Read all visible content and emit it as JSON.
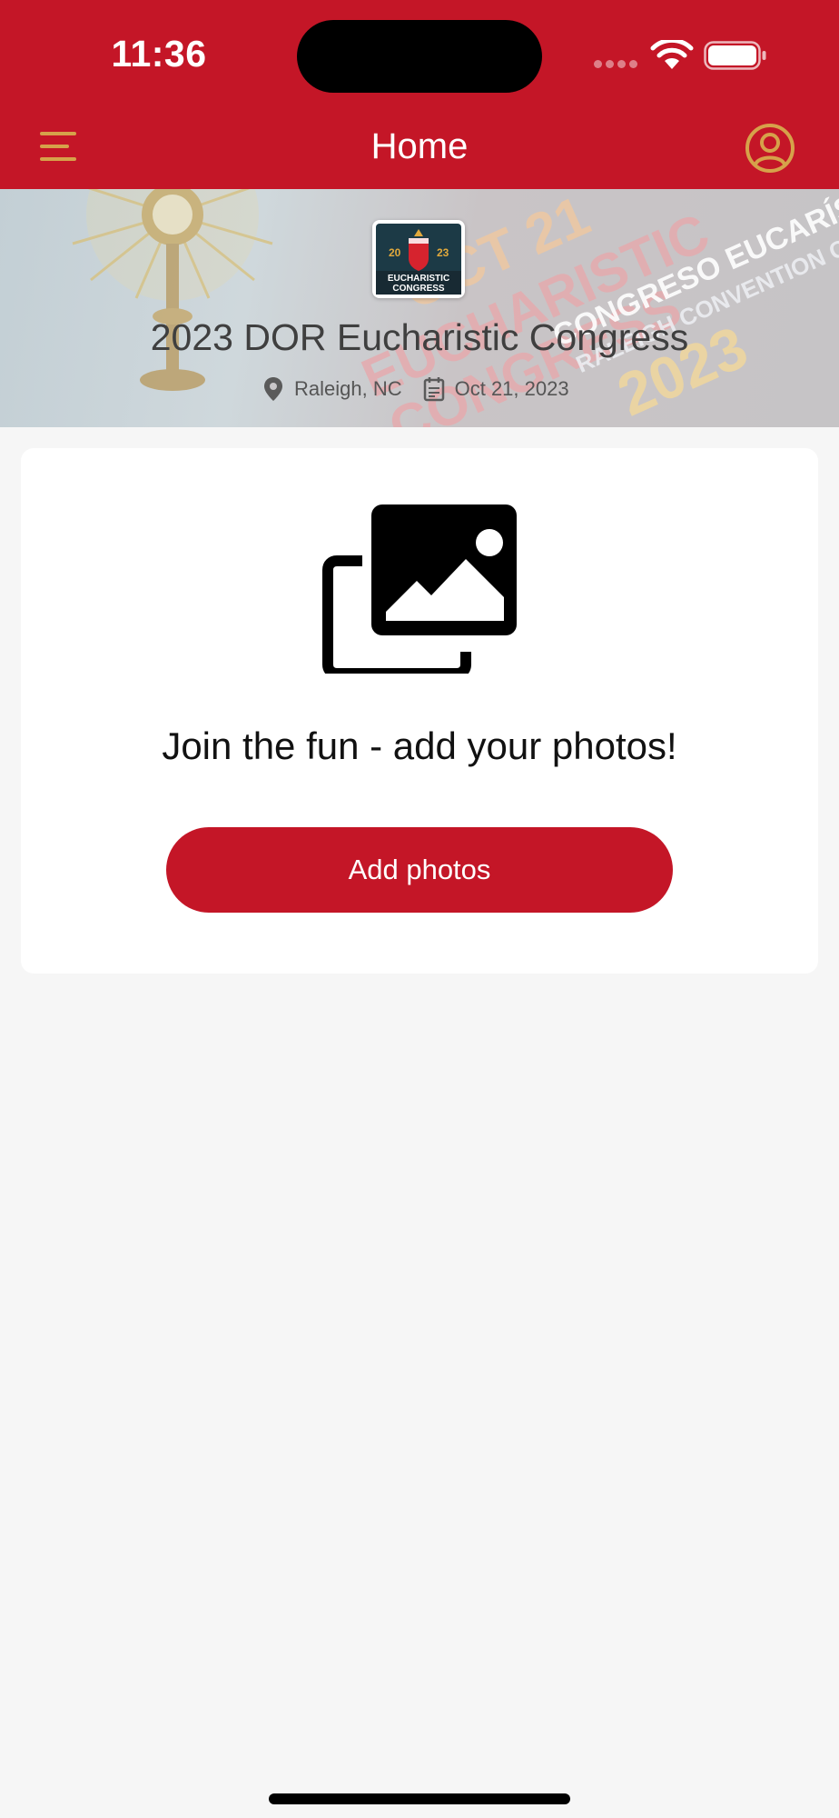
{
  "status_bar": {
    "time": "11:36"
  },
  "header": {
    "title": "Home",
    "menu_icon": "hamburger-menu-icon",
    "profile_icon": "user-circle-icon"
  },
  "event": {
    "title": "2023 DOR Eucharistic Congress",
    "location": "Raleigh, NC",
    "date": "Oct 21, 2023",
    "location_icon": "map-pin-icon",
    "date_icon": "calendar-icon",
    "logo_text": {
      "year_left": "20",
      "year_right": "23",
      "line1": "EUCHARISTIC",
      "line2": "CONGRESS"
    },
    "banner_text": {
      "line1": "OCT 21",
      "line2": "EUCHARISTIC",
      "line3": "CONGRESS",
      "line4": "CONGRESO EUCARÍS",
      "line5": "RALEIGH CONVENTION CENT",
      "line6": "2023"
    }
  },
  "empty_state": {
    "icon": "photo-gallery-icon",
    "message": "Join the fun - add your photos!",
    "button_label": "Add photos"
  },
  "colors": {
    "brand_red": "#c41627",
    "accent_gold": "#d6a24a",
    "background": "#f6f6f6"
  }
}
